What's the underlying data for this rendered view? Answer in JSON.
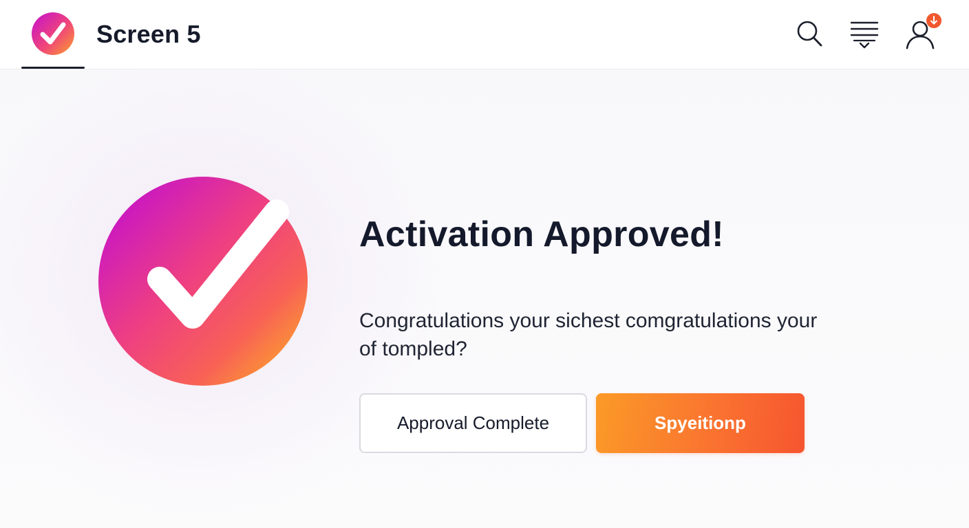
{
  "header": {
    "title": "Screen 5",
    "logo_icon": "check-circle-logo-icon",
    "actions": [
      {
        "icon": "search-icon"
      },
      {
        "icon": "filter-list-icon"
      },
      {
        "icon": "user-profile-icon",
        "badge_icon": "arrow-down-badge-icon",
        "badge_color": "#f2582e"
      }
    ]
  },
  "main": {
    "hero_icon": "check-circle-icon",
    "headline": "Activation Approved!",
    "message": "Congratulations your sichest comgratulations your of tompled?",
    "secondary_button": "Approval Complete",
    "primary_button": "Spyeitionp"
  },
  "colors": {
    "gradient_start": "#c20fd0",
    "gradient_mid": "#f0457a",
    "gradient_end": "#fba12a",
    "primary_button": "#fa7430",
    "text": "#141a2b"
  }
}
